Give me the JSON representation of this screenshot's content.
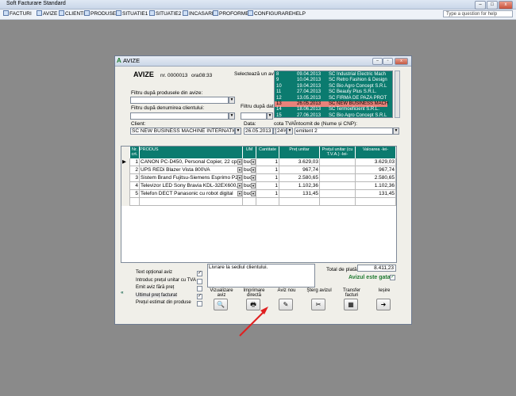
{
  "app": {
    "title": "Soft Facturare Standard",
    "menu": [
      "FACTURI",
      "AVIZE",
      "CLIENTI",
      "PRODUSE",
      "SITUATIE1",
      "SITUATIE2",
      "INCASARI",
      "PROFORME",
      "CONFIGURARE",
      "HELP"
    ],
    "help_placeholder": "Type a question for help"
  },
  "window": {
    "title": "AVIZE",
    "heading": "AVIZE",
    "nr_label": "nr. 0000013",
    "ora_label": "ora:",
    "ora_value": "08:33",
    "select_label": "Selectează un aviz:",
    "filter_products_label": "Filtru după produsele din avize:",
    "filter_client_label": "Filtru după denumirea clientului:",
    "filter_date_label": "Filtru după dată:",
    "client_label": "Client:",
    "client_value": "SC NEW BUSINESS MACHINE INTERNATIONAL",
    "data_label": "Data:",
    "data_value": "26.05.2013",
    "tva_label": "cota TVA",
    "tva_value": "24%",
    "intocmit_label": "Întocmit de (Nume și CNP):",
    "intocmit_value": "emitent 2"
  },
  "aviz_list": [
    {
      "nr": "8",
      "date": "09.04.2013",
      "client": "SC Industrial Electric Mach"
    },
    {
      "nr": "9",
      "date": "10.04.2013",
      "client": "SC Retro Fashion & Design"
    },
    {
      "nr": "10",
      "date": "19.04.2013",
      "client": "SC Bio Agro Concept S.R.L"
    },
    {
      "nr": "11",
      "date": "27.04.2013",
      "client": "SC Beauty Plus S.R.L."
    },
    {
      "nr": "12",
      "date": "13.05.2013",
      "client": "SC FIRMA DE PAZA PROT"
    },
    {
      "nr": "13",
      "date": "26.05.2013",
      "client": "SC NEW BUSINESS MACH"
    },
    {
      "nr": "14",
      "date": "18.06.2013",
      "client": "SC Termoeficient S.R.L."
    },
    {
      "nr": "15",
      "date": "27.06.2013",
      "client": "SC Bio Agro Concept S.R.L"
    }
  ],
  "table": {
    "headers": [
      "Nr. crt.",
      "PRODUS",
      "UM",
      "Cantitate",
      "Preț unitar",
      "Prețul unitar (cu T.V.A.) -lei-",
      "Valoarea -lei-"
    ],
    "rows": [
      {
        "nr": "1",
        "produs": "CANON PC-D450, Personal Copier, 22 cpm",
        "um": "buc",
        "cant": "1",
        "pret": "3.629,03",
        "pret_tva": "",
        "valoare": "3.629,03"
      },
      {
        "nr": "2",
        "produs": "UPS REDi Blazer Vista 800VA",
        "um": "buc",
        "cant": "1",
        "pret": "967,74",
        "pret_tva": "",
        "valoare": "967,74"
      },
      {
        "nr": "3",
        "produs": "Sistem Brand Fujitsu-Siemens Esprimo P25",
        "um": "buc",
        "cant": "1",
        "pret": "2.580,65",
        "pret_tva": "",
        "valoare": "2.580,65"
      },
      {
        "nr": "4",
        "produs": "Televizor LED Sony Bravia KDL-32EX600, 3",
        "um": "buc",
        "cant": "1",
        "pret": "1.102,36",
        "pret_tva": "",
        "valoare": "1.102,36"
      },
      {
        "nr": "5",
        "produs": "Telefon DECT Panasonic cu robot digital",
        "um": "buc",
        "cant": "1",
        "pret": "131,45",
        "pret_tva": "",
        "valoare": "131,45"
      }
    ]
  },
  "options": [
    {
      "label": "Text opțional aviz",
      "checked": true
    },
    {
      "label": "Introduc prețul unitar cu TVA",
      "checked": false
    },
    {
      "label": "Emit aviz fără preț",
      "checked": false
    },
    {
      "label": "Ultimul preț facturat",
      "checked": true
    },
    {
      "label": "Prețul estimat din produse",
      "checked": false
    }
  ],
  "note_text": "Livrare la sediul clientului.",
  "total_label": "Total de plată:",
  "total_value": "8.411,23",
  "ready_label": "Avizul este gata",
  "buttons": [
    {
      "label1": "Vizualizare",
      "label2": "aviz",
      "icon": "preview-icon"
    },
    {
      "label1": "Imprimare",
      "label2": "directă",
      "icon": "printer-icon"
    },
    {
      "label1": "Aviz nou",
      "label2": "",
      "icon": "new-document-icon"
    },
    {
      "label1": "Șterg avizul",
      "label2": "",
      "icon": "delete-icon"
    },
    {
      "label1": "Transfer",
      "label2": "facturi",
      "icon": "calculator-icon"
    },
    {
      "label1": "Ieșire",
      "label2": "",
      "icon": "exit-icon"
    }
  ],
  "colors": {
    "accent": "#0b7b6f",
    "selected": "#e8827a",
    "ready": "#1f7a30",
    "arrow": "#e02020"
  }
}
